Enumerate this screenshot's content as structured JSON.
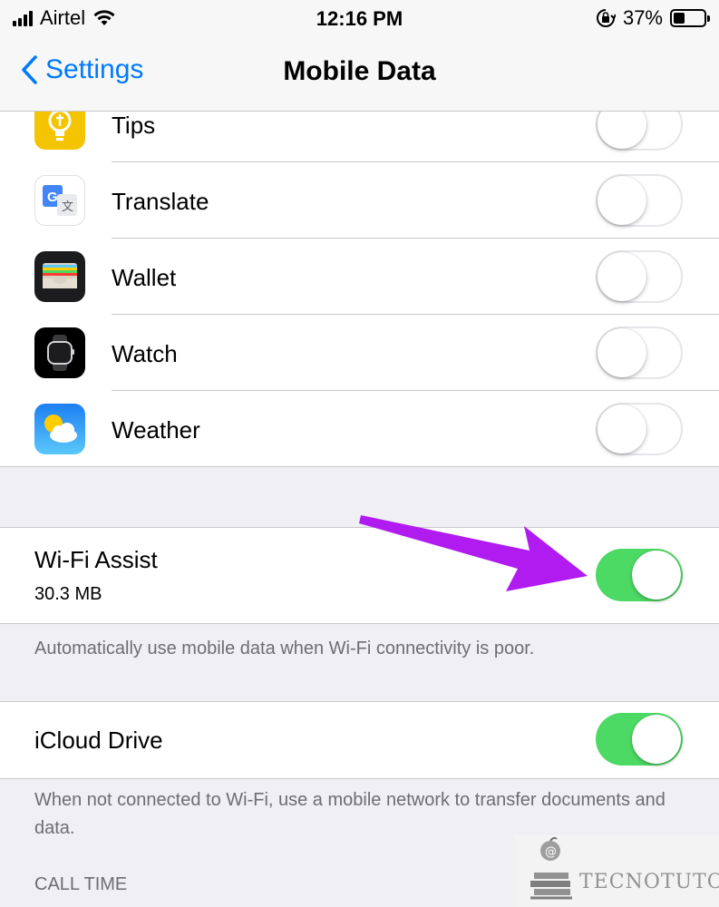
{
  "status_bar": {
    "carrier": "Airtel",
    "time": "12:16 PM",
    "battery_percent": "37%",
    "battery_level": 0.37
  },
  "nav": {
    "back_label": "Settings",
    "title": "Mobile Data"
  },
  "apps": [
    {
      "label": "Tips",
      "icon": "tips-icon",
      "enabled": false
    },
    {
      "label": "Translate",
      "icon": "translate-icon",
      "enabled": false
    },
    {
      "label": "Wallet",
      "icon": "wallet-icon",
      "enabled": false
    },
    {
      "label": "Watch",
      "icon": "watch-icon",
      "enabled": false
    },
    {
      "label": "Weather",
      "icon": "weather-icon",
      "enabled": false
    }
  ],
  "wifi_assist": {
    "title": "Wi-Fi Assist",
    "usage": "30.3 MB",
    "enabled": true,
    "footer": "Automatically use mobile data when Wi-Fi connectivity is poor."
  },
  "icloud_drive": {
    "title": "iCloud Drive",
    "enabled": true,
    "footer": "When not connected to Wi-Fi, use a mobile network to transfer documents and data."
  },
  "call_time": {
    "header": "CALL TIME"
  },
  "watermark": {
    "text": "TECNOTUTO"
  },
  "colors": {
    "accent": "#007aff",
    "toggle_on": "#4cd964",
    "annotation_arrow": "#b01cf0"
  }
}
